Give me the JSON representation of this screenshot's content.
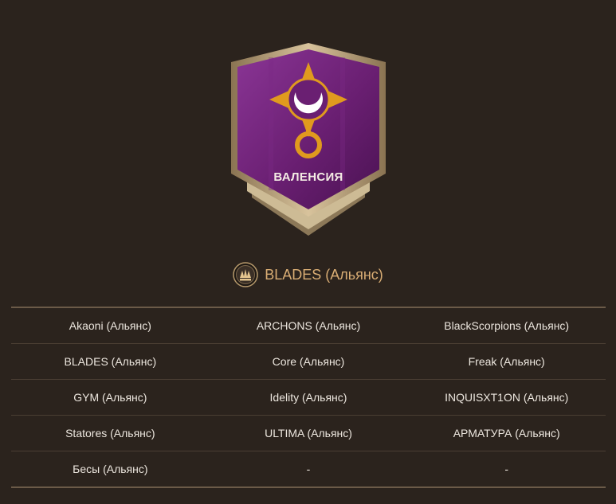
{
  "crest": {
    "title": "ВАЛЕНСИЯ",
    "emblem": "crescent-moon-ring-emblem",
    "banner_color": "#6a1f72",
    "emblem_color": "#e09a1e"
  },
  "owner": {
    "icon": "alliance-crest-icon",
    "name": "BLADES (Альянс)"
  },
  "alliances": {
    "rows": [
      [
        "Akaoni (Альянс)",
        "ARCHONS (Альянс)",
        "BlackScorpions (Альянс)"
      ],
      [
        "BLADES (Альянс)",
        "Core (Альянс)",
        "Freak (Альянс)"
      ],
      [
        "GYM (Альянс)",
        "Idelity (Альянс)",
        "INQUISXT1ON (Альянс)"
      ],
      [
        "Statores (Альянс)",
        "ULTIMA (Альянс)",
        "АРМАТУРА (Альянс)"
      ],
      [
        "Бесы (Альянс)",
        "-",
        "-"
      ]
    ]
  },
  "colors": {
    "background": "#2b231d",
    "owner_text": "#d9ad74",
    "cell_text": "#ece6de"
  }
}
